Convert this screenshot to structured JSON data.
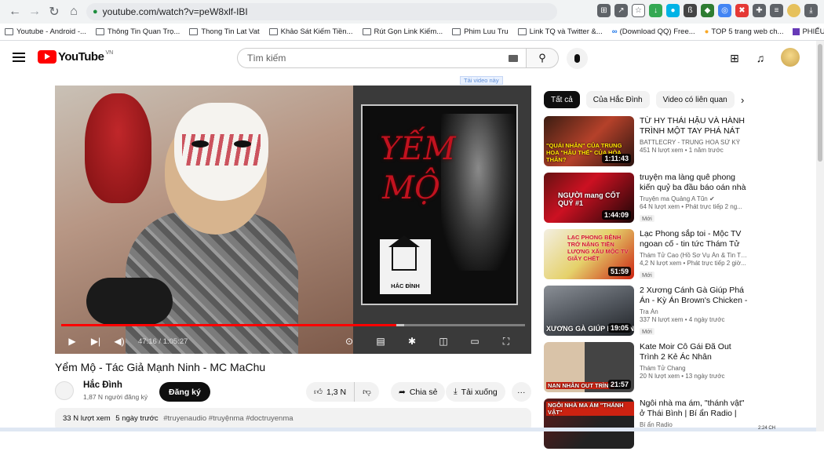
{
  "browser": {
    "url": "youtube.com/watch?v=peW8xlf-IBI",
    "bookmarks": [
      "Youtube - Android -...",
      "Thông Tin Quan Trọ...",
      "Thong Tin Lat Vat",
      "Khảo Sát Kiếm Tiền...",
      "Rút Gọn Link Kiếm...",
      "Phim Luu Tru",
      "Link TQ và Twitter &...",
      "(Download QQ) Free...",
      "TOP 5 trang web ch...",
      "PHIẾU ĐĂNG KÝ TH..."
    ],
    "bookmarks_more": "»"
  },
  "header": {
    "logo_text": "YouTube",
    "region": "VN",
    "search_placeholder": "Tìm kiếm"
  },
  "ad_label": "Tải video này",
  "player": {
    "poster_title": "YẾM MỘ",
    "channel_logo_text": "HẮC ĐÌNH",
    "time_current": "47:16",
    "time_total": "1:05:27",
    "time_display": "47:16 / 1:05:27",
    "progress_played": 0.722,
    "progress_loaded": 0.74
  },
  "video": {
    "title": "Yểm Mộ - Tác Giả Mạnh Ninh - MC MaChu",
    "channel": "Hắc Đình",
    "subscribers": "1,87 N người đăng ký",
    "subscribe_label": "Đăng ký",
    "likes": "1,3 N",
    "share_label": "Chia sẻ",
    "download_label": "Tải xuống",
    "more_label": "···",
    "views": "33 N lượt xem",
    "age": "5 ngày trước",
    "tags": "#truyenaudio #truyệnma #doctruyenma"
  },
  "chips": [
    "Tất cả",
    "Của Hắc Đình",
    "Video có liên quan"
  ],
  "recommendations": [
    {
      "title": "TỪ HY THÁI HẬU VÀ HÀNH TRÌNH MỘT TAY PHÁ NÁT CƠ...",
      "channel": "BATTLECRY - TRUNG HOA SỬ KÝ",
      "meta": "451 N lượt xem • 1 năm trước",
      "duration": "1:11:43",
      "thumb_caption": "\"QUÁI NHÂN\" CỦA TRUNG HOA \"HẬU THẾ\" CỦA HÒA THÂN?",
      "badge": ""
    },
    {
      "title": "truyện ma làng quê phong kiến quỷ ba đầu báo oán nhà Chán...",
      "channel": "Truyện ma Quảng A Tũn ✔",
      "meta": "64 N lượt xem • Phát trực tiếp 2 ng...",
      "duration": "1:44:09",
      "thumb_caption": "NGƯỜI mang CỐT QUỶ #1",
      "badge": "Mới"
    },
    {
      "title": "Lạc Phong sắp toi - Mộc TV ngoan cố - tin tức Thám Tử Cao",
      "channel": "Thám Tử Cao (Hồ Sơ Vụ Án & Tin Tứ...",
      "meta": "4,2 N lượt xem • Phát trực tiếp 2 giờ...",
      "duration": "51:59",
      "thumb_caption": "LẠC PHONG BỆNH TRỞ NẶNG TIỀN LƯỢNG XẤU MỘC TV GIÃY CHẾT",
      "badge": "Mới"
    },
    {
      "title": "2 Xương Cánh Gà Giúp Phá Án - Kỳ Án Brown's Chicken - Tra Án",
      "channel": "Tra Án",
      "meta": "337 N lượt xem • 4 ngày trước",
      "duration": "19:05",
      "thumb_caption": "XƯƠNG GÀ GIÚP PHÁ ÁN",
      "badge": "Mới"
    },
    {
      "title": "Kate Moir Cô Gái Đã Out Trình 2 Kẻ Ác Nhân",
      "channel": "Thám Tử Chang",
      "meta": "20 N lượt xem • 13 ngày trước",
      "duration": "21:57",
      "thumb_caption": "NẠN NHÂN OUT TRÌNH",
      "badge": ""
    },
    {
      "title": "Ngôi nhà ma ám, \"thánh vật\" ở Thái Bình | Bí ẩn Radio | MC Tả...",
      "channel": "Bí ẩn Radio",
      "meta": "",
      "duration": "",
      "thumb_caption": "NGÔI NHÀ MA ÁM \"THÁNH VẬT\"",
      "badge": ""
    }
  ],
  "taskbar": {
    "time": "2:24 CH"
  },
  "colors": {
    "brand_red": "#ff0000",
    "chip_active": "#0f0f0f"
  },
  "icons": {
    "back": "arrow-left-icon",
    "forward": "arrow-right-icon",
    "reload": "reload-icon",
    "home": "home-icon",
    "search": "search-icon",
    "mic": "mic-icon",
    "create": "create-video-icon",
    "bell": "bell-icon"
  }
}
